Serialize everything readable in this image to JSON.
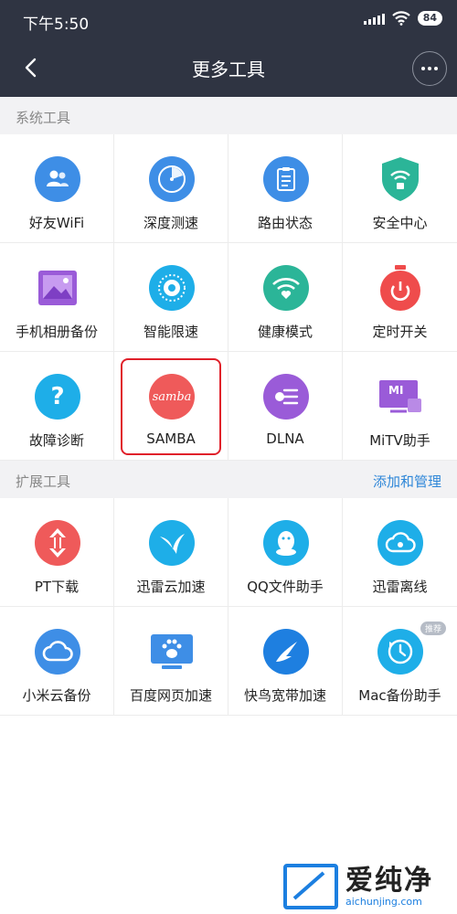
{
  "status_bar": {
    "time": "下午5:50",
    "battery": "84"
  },
  "header": {
    "title": "更多工具"
  },
  "sections": {
    "system": {
      "title": "系统工具"
    },
    "extension": {
      "title": "扩展工具",
      "action": "添加和管理"
    }
  },
  "system_tools": [
    {
      "label": "好友WiFi",
      "icon": "friends-wifi-icon",
      "color": "#3e8ee6"
    },
    {
      "label": "深度测速",
      "icon": "speed-test-icon",
      "color": "#3e8ee6"
    },
    {
      "label": "路由状态",
      "icon": "router-status-icon",
      "color": "#3e8ee6"
    },
    {
      "label": "安全中心",
      "icon": "security-shield-icon",
      "color": "#2bb598"
    },
    {
      "label": "手机相册备份",
      "icon": "photo-album-icon",
      "color": "#9a5bd8"
    },
    {
      "label": "智能限速",
      "icon": "smart-limit-icon",
      "color": "#1eaee8"
    },
    {
      "label": "健康模式",
      "icon": "health-wifi-icon",
      "color": "#2bb598"
    },
    {
      "label": "定时开关",
      "icon": "timer-switch-icon",
      "color": "#ef4c4c"
    },
    {
      "label": "故障诊断",
      "icon": "question-icon",
      "color": "#1eaee8"
    },
    {
      "label": "SAMBA",
      "icon": "samba-icon",
      "color": "#ef5a5a",
      "icon_text": "samba"
    },
    {
      "label": "DLNA",
      "icon": "dlna-icon",
      "color": "#9a5bd8"
    },
    {
      "label": "MiTV助手",
      "icon": "mitv-icon",
      "color": "#9a5bd8",
      "icon_text": "MI"
    }
  ],
  "extension_tools": [
    {
      "label": "PT下载",
      "icon": "pt-download-icon",
      "color": "#ef5a5a"
    },
    {
      "label": "迅雷云加速",
      "icon": "xunlei-bird-icon",
      "color": "#1eaee8"
    },
    {
      "label": "QQ文件助手",
      "icon": "qq-penguin-icon",
      "color": "#1eaee8"
    },
    {
      "label": "迅雷离线",
      "icon": "cloud-offline-icon",
      "color": "#1eaee8"
    },
    {
      "label": "小米云备份",
      "icon": "mi-cloud-icon",
      "color": "#3e8ee6"
    },
    {
      "label": "百度网页加速",
      "icon": "baidu-paw-icon",
      "color": "#3e8ee6"
    },
    {
      "label": "快鸟宽带加速",
      "icon": "swift-bird-icon",
      "color": "#1e7fe0"
    },
    {
      "label": "Mac备份助手",
      "icon": "mac-backup-icon",
      "color": "#1eaee8",
      "badge": "推荐"
    }
  ],
  "watermark": {
    "main": "爱纯净",
    "sub": "aichunjing.com"
  }
}
